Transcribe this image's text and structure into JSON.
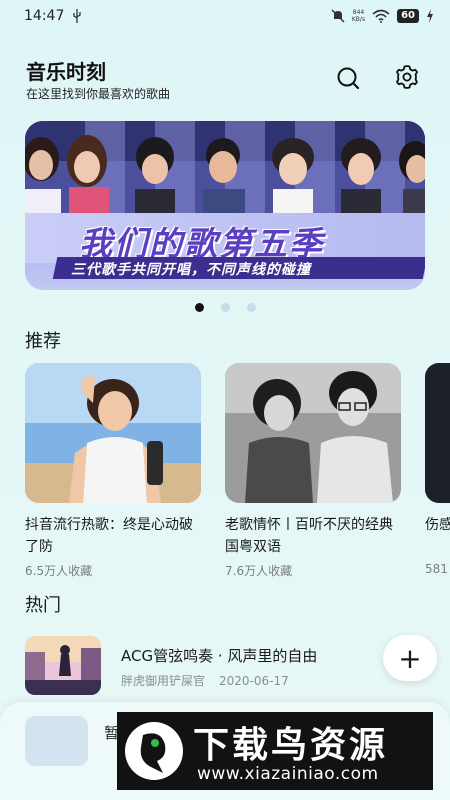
{
  "status_bar": {
    "time": "14:47",
    "net_speed_value": "844",
    "net_speed_unit": "KB/s",
    "battery": "60"
  },
  "header": {
    "title": "音乐时刻",
    "subtitle": "在这里找到你最喜欢的歌曲",
    "search_icon": "search-icon",
    "settings_icon": "gear-icon"
  },
  "banner": {
    "title": "我们的歌第五季",
    "subtitle": "三代歌手共同开唱，不同声线的碰撞",
    "dot_count": 3,
    "active_dot": 0
  },
  "recommend": {
    "title": "推荐",
    "items": [
      {
        "title": "抖音流行热歌：终是心动破了防",
        "count": "6.5万人收藏"
      },
      {
        "title": "老歌情怀丨百听不厌的经典国粤双语",
        "count": "7.6万人收藏"
      },
      {
        "title": "伤感记得",
        "count": "581"
      }
    ]
  },
  "hot": {
    "title": "热门",
    "items": [
      {
        "title": "ACG管弦鸣奏 · 风声里的自由",
        "author": "胖虎御用铲屎官",
        "date": "2020-06-17"
      }
    ],
    "add_label": "+"
  },
  "player": {
    "text": "暂"
  },
  "watermark": {
    "main": "下载鸟资源",
    "url": "www.xiazainiao.com"
  },
  "colors": {
    "background": "#e0f6f6",
    "banner_title": "#5b3fc2",
    "active_dot": "#111111",
    "inactive_dot": "#c4dde6"
  }
}
